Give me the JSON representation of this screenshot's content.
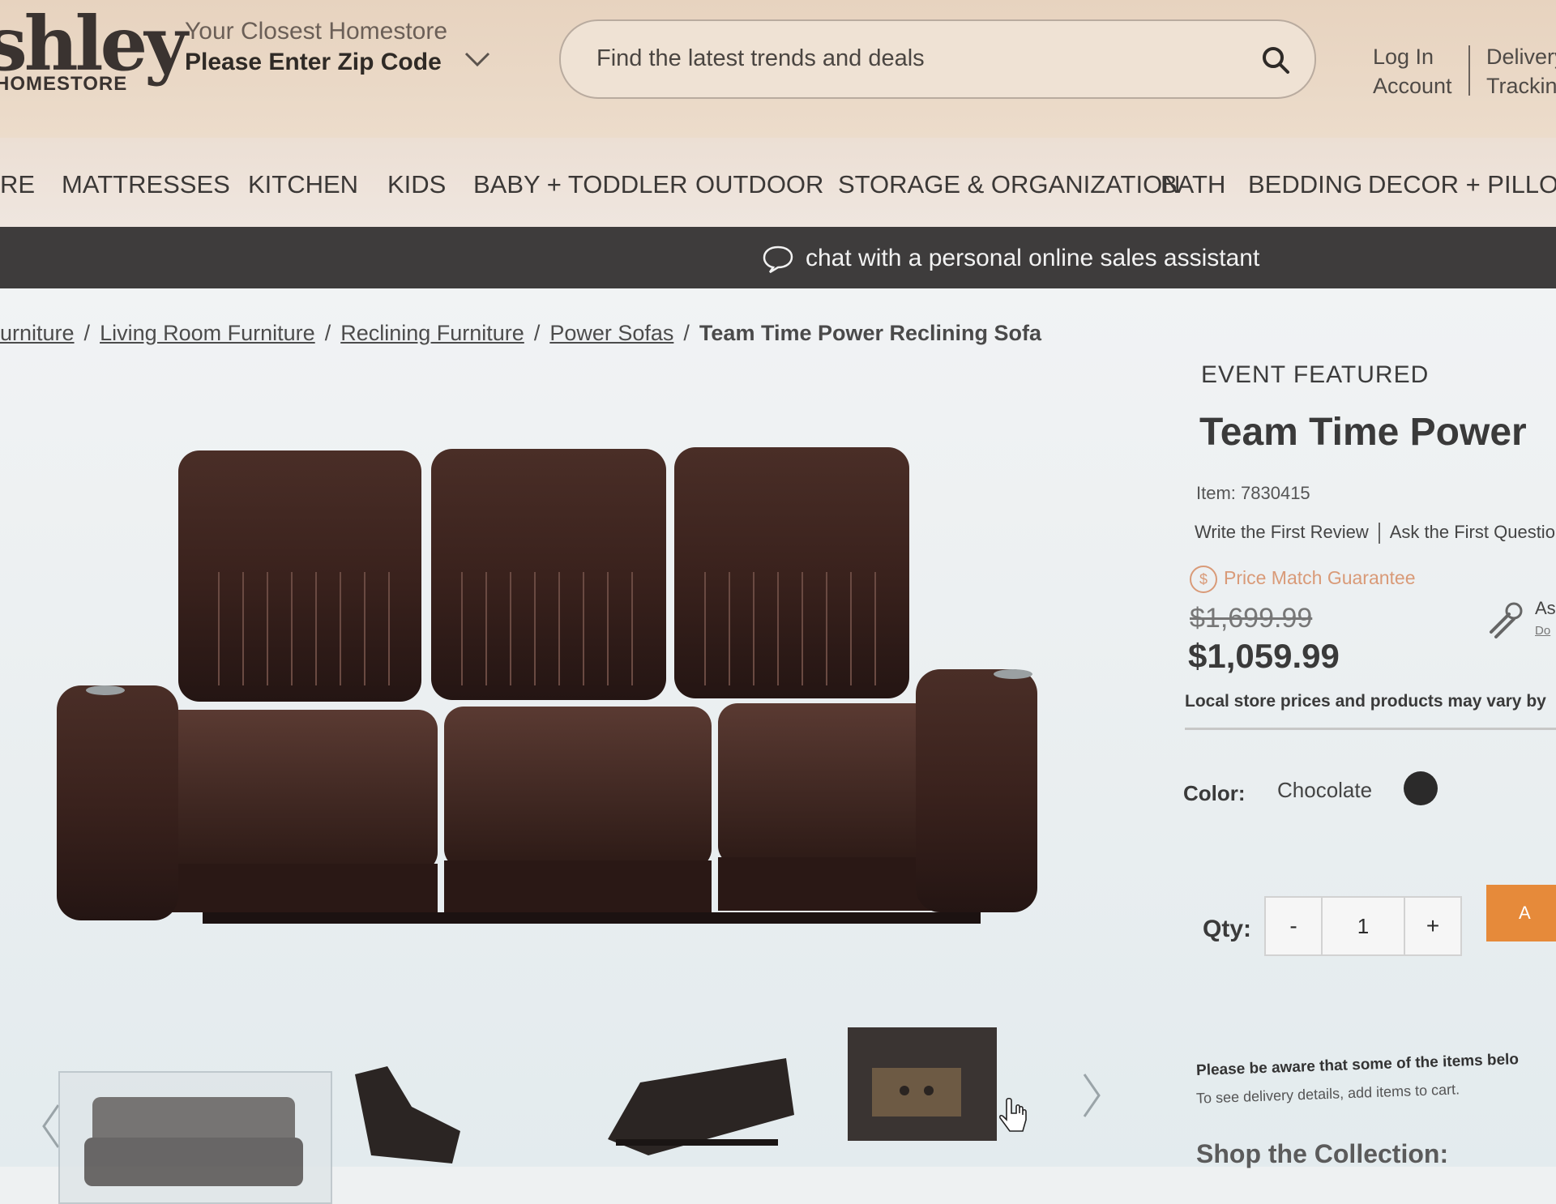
{
  "header": {
    "logo_word": "shley",
    "logo_sub": "HOMESTORE",
    "zip_prompt_top": "Your Closest Homestore",
    "zip_prompt_main": "Please Enter Zip Code",
    "search_placeholder": "Find the latest trends and deals",
    "account_line1": "Log In",
    "account_line2": "Account",
    "delivery_line1": "Delivery",
    "delivery_line2": "Tracking"
  },
  "nav": {
    "items": [
      "RE",
      "MATTRESSES",
      "KITCHEN",
      "KIDS",
      "BABY + TODDLER",
      "OUTDOOR",
      "STORAGE & ORGANIZATION",
      "BATH",
      "BEDDING",
      "DECOR + PILLOWS"
    ]
  },
  "chat": {
    "text": "chat with a personal online sales assistant"
  },
  "breadcrumb": {
    "links": [
      "urniture",
      "Living Room Furniture",
      "Reclining Furniture",
      "Power Sofas"
    ],
    "current": "Team Time Power Reclining Sofa"
  },
  "product": {
    "event": "EVENT FEATURED",
    "title": "Team Time Power",
    "item": "Item: 7830415",
    "review_link": "Write the First Review",
    "question_link": "Ask the First Questio",
    "price_match": "Price Match Guarantee",
    "price_match_symbol": "$",
    "old_price": "$1,699.99",
    "price": "$1,059.99",
    "side_label": "As",
    "side_sub": "Do",
    "local_note": "Local store prices and products may vary by",
    "color_label": "Color:",
    "color_value": "Chocolate",
    "swatch_color": "#2b2a2a",
    "qty_label": "Qty:",
    "qty_minus": "-",
    "qty_value": "1",
    "qty_plus": "+",
    "add_label": "A",
    "notice_line1": "Please be aware that some of the items belo",
    "notice_line2": "To see delivery details, add items to cart.",
    "collection_heading": "Shop the Collection:"
  },
  "colors": {
    "accent": "#e68a3a",
    "chat_bar": "#3e3c3c",
    "header_bg": "#e7d3bf"
  }
}
